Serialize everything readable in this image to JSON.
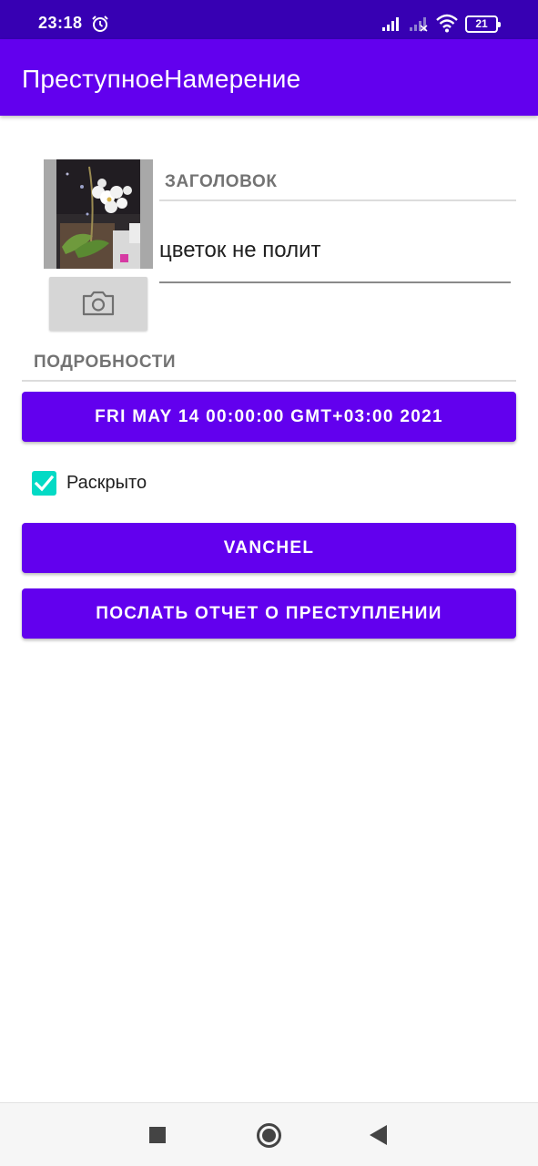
{
  "status_bar": {
    "time": "23:18",
    "battery": "21",
    "icons": [
      "alarm-icon",
      "signal-icon",
      "signal-empty-icon",
      "wifi-icon",
      "battery-icon"
    ]
  },
  "app_bar": {
    "title": "ПреступноеНамерение"
  },
  "crime": {
    "photo_icon": "camera-icon",
    "title_label": "ЗАГОЛОВОК",
    "title_value": "цветок не полит",
    "details_label": "ПОДРОБНОСТИ",
    "date_button": "FRI MAY 14 00:00:00 GMT+03:00 2021",
    "solved_label": "Раскрыто",
    "solved_checked": true,
    "suspect_button": "VANCHEL",
    "report_button": "ПОСЛАТЬ ОТЧЕТ О ПРЕСТУПЛЕНИИ"
  },
  "colors": {
    "status_bar": "#3700b3",
    "primary": "#6200ee",
    "accent": "#03dac5"
  },
  "nav_bar": {
    "icons": [
      "recents-icon",
      "home-icon",
      "back-icon"
    ]
  }
}
